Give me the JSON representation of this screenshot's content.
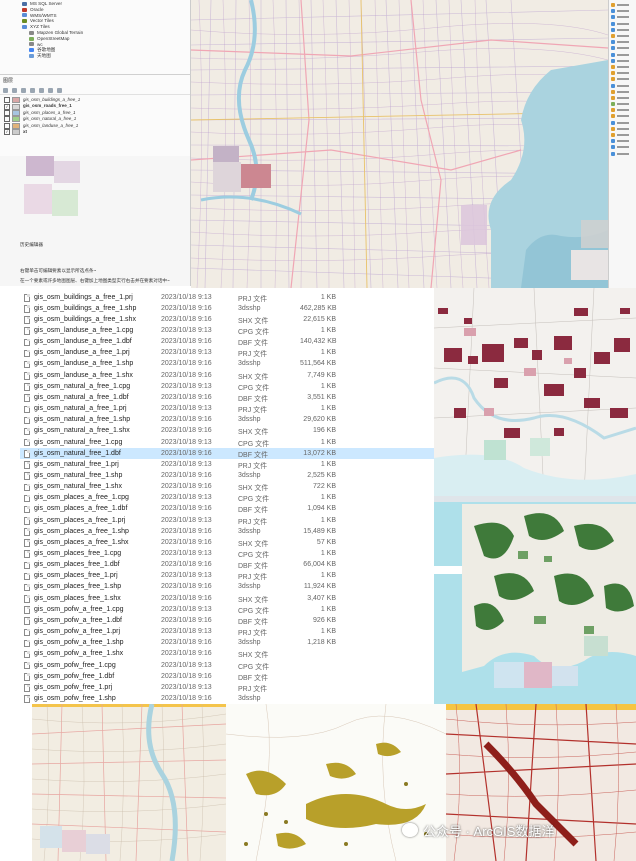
{
  "qgis": {
    "browser_items": [
      {
        "label": "MS SQL Server",
        "color": "#4a6fa5"
      },
      {
        "label": "Oracle",
        "color": "#c0392b"
      },
      {
        "label": "WMS/WMTS",
        "color": "#5b8dd6"
      },
      {
        "label": "Vector Tiles",
        "color": "#6b8e23"
      },
      {
        "label": "XYZ Tiles",
        "color": "#5b8dd6"
      },
      {
        "label": "Mapzen Global Terrain",
        "color": "#888888"
      },
      {
        "label": "OpenStreetMap",
        "color": "#7cae5a"
      },
      {
        "label": "wc",
        "color": "#888888"
      },
      {
        "label": "谷歌地图",
        "color": "#4285f4"
      },
      {
        "label": "天地图",
        "color": "#6a9bd8"
      }
    ],
    "layers_title": "图层",
    "layers": [
      {
        "label": "gis_osm_buildings_a_free_1",
        "checked": "",
        "swatch": "#d9a7a7",
        "bold": false
      },
      {
        "label": "gis_osm_roads_free_1",
        "checked": "✓",
        "swatch": "#d8d8d8",
        "bold": true
      },
      {
        "label": "gis_osm_places_a_free_1",
        "checked": "",
        "swatch": "#a7c4e0",
        "bold": false
      },
      {
        "label": "gis_osm_natural_a_free_1",
        "checked": "",
        "swatch": "#9fcf8a",
        "bold": false
      },
      {
        "label": "gis_osm_landuse_a_free_1",
        "checked": "",
        "swatch": "#e0b27a",
        "bold": false
      },
      {
        "label": "xt",
        "checked": "✓",
        "swatch": "#cccccc",
        "bold": true
      }
    ],
    "bottom_caption": "历史编辑器",
    "bottom_notice_1": "右键单击可编辑要素以显示所选点条~",
    "bottom_notice_2": "在一个要素或许多地图图层、右键加上地图类型实行右击并在要素对话中~",
    "right_panel_icons": [
      "#e0a030",
      "#4a90d9",
      "#4a90d9",
      "#4a90d9",
      "#4a90d9",
      "#e0a030",
      "#4a90d9",
      "#4a90d9",
      "#4a90d9",
      "#4a90d9",
      "#e0a030",
      "#e0a030",
      "#e0a030",
      "#4a90d9",
      "#e0a030",
      "#e0a030",
      "#7cae5a",
      "#e0a030",
      "#e0a030",
      "#4a90d9",
      "#e0a030",
      "#e0a030",
      "#4a90d9",
      "#4a90d9",
      "#4a90d9"
    ]
  },
  "files": [
    {
      "name": "gis_osm_buildings_a_free_1.prj",
      "date": "2023/10/18 9:13",
      "type": "PRJ 文件",
      "size": "1 KB"
    },
    {
      "name": "gis_osm_buildings_a_free_1.shp",
      "date": "2023/10/18 9:16",
      "type": "3dsshp",
      "size": "462,285 KB"
    },
    {
      "name": "gis_osm_buildings_a_free_1.shx",
      "date": "2023/10/18 9:16",
      "type": "SHX 文件",
      "size": "22,615 KB"
    },
    {
      "name": "gis_osm_landuse_a_free_1.cpg",
      "date": "2023/10/18 9:13",
      "type": "CPG 文件",
      "size": "1 KB"
    },
    {
      "name": "gis_osm_landuse_a_free_1.dbf",
      "date": "2023/10/18 9:16",
      "type": "DBF 文件",
      "size": "140,432 KB"
    },
    {
      "name": "gis_osm_landuse_a_free_1.prj",
      "date": "2023/10/18 9:13",
      "type": "PRJ 文件",
      "size": "1 KB"
    },
    {
      "name": "gis_osm_landuse_a_free_1.shp",
      "date": "2023/10/18 9:16",
      "type": "3dsshp",
      "size": "511,564 KB"
    },
    {
      "name": "gis_osm_landuse_a_free_1.shx",
      "date": "2023/10/18 9:16",
      "type": "SHX 文件",
      "size": "7,749 KB"
    },
    {
      "name": "gis_osm_natural_a_free_1.cpg",
      "date": "2023/10/18 9:13",
      "type": "CPG 文件",
      "size": "1 KB"
    },
    {
      "name": "gis_osm_natural_a_free_1.dbf",
      "date": "2023/10/18 9:16",
      "type": "DBF 文件",
      "size": "3,551 KB"
    },
    {
      "name": "gis_osm_natural_a_free_1.prj",
      "date": "2023/10/18 9:13",
      "type": "PRJ 文件",
      "size": "1 KB"
    },
    {
      "name": "gis_osm_natural_a_free_1.shp",
      "date": "2023/10/18 9:16",
      "type": "3dsshp",
      "size": "29,620 KB"
    },
    {
      "name": "gis_osm_natural_a_free_1.shx",
      "date": "2023/10/18 9:16",
      "type": "SHX 文件",
      "size": "196 KB"
    },
    {
      "name": "gis_osm_natural_free_1.cpg",
      "date": "2023/10/18 9:13",
      "type": "CPG 文件",
      "size": "1 KB"
    },
    {
      "name": "gis_osm_natural_free_1.dbf",
      "date": "2023/10/18 9:16",
      "type": "DBF 文件",
      "size": "13,072 KB",
      "selected": true
    },
    {
      "name": "gis_osm_natural_free_1.prj",
      "date": "2023/10/18 9:13",
      "type": "PRJ 文件",
      "size": "1 KB"
    },
    {
      "name": "gis_osm_natural_free_1.shp",
      "date": "2023/10/18 9:16",
      "type": "3dsshp",
      "size": "2,525 KB"
    },
    {
      "name": "gis_osm_natural_free_1.shx",
      "date": "2023/10/18 9:16",
      "type": "SHX 文件",
      "size": "722 KB"
    },
    {
      "name": "gis_osm_places_a_free_1.cpg",
      "date": "2023/10/18 9:13",
      "type": "CPG 文件",
      "size": "1 KB"
    },
    {
      "name": "gis_osm_places_a_free_1.dbf",
      "date": "2023/10/18 9:16",
      "type": "DBF 文件",
      "size": "1,094 KB"
    },
    {
      "name": "gis_osm_places_a_free_1.prj",
      "date": "2023/10/18 9:13",
      "type": "PRJ 文件",
      "size": "1 KB"
    },
    {
      "name": "gis_osm_places_a_free_1.shp",
      "date": "2023/10/18 9:16",
      "type": "3dsshp",
      "size": "15,489 KB"
    },
    {
      "name": "gis_osm_places_a_free_1.shx",
      "date": "2023/10/18 9:16",
      "type": "SHX 文件",
      "size": "57 KB"
    },
    {
      "name": "gis_osm_places_free_1.cpg",
      "date": "2023/10/18 9:13",
      "type": "CPG 文件",
      "size": "1 KB"
    },
    {
      "name": "gis_osm_places_free_1.dbf",
      "date": "2023/10/18 9:16",
      "type": "DBF 文件",
      "size": "66,004 KB"
    },
    {
      "name": "gis_osm_places_free_1.prj",
      "date": "2023/10/18 9:13",
      "type": "PRJ 文件",
      "size": "1 KB"
    },
    {
      "name": "gis_osm_places_free_1.shp",
      "date": "2023/10/18 9:16",
      "type": "3dsshp",
      "size": "11,924 KB"
    },
    {
      "name": "gis_osm_places_free_1.shx",
      "date": "2023/10/18 9:16",
      "type": "SHX 文件",
      "size": "3,407 KB"
    },
    {
      "name": "gis_osm_pofw_a_free_1.cpg",
      "date": "2023/10/18 9:13",
      "type": "CPG 文件",
      "size": "1 KB"
    },
    {
      "name": "gis_osm_pofw_a_free_1.dbf",
      "date": "2023/10/18 9:16",
      "type": "DBF 文件",
      "size": "926 KB"
    },
    {
      "name": "gis_osm_pofw_a_free_1.prj",
      "date": "2023/10/18 9:13",
      "type": "PRJ 文件",
      "size": "1 KB"
    },
    {
      "name": "gis_osm_pofw_a_free_1.shp",
      "date": "2023/10/18 9:16",
      "type": "3dsshp",
      "size": "1,218 KB"
    },
    {
      "name": "gis_osm_pofw_a_free_1.shx",
      "date": "2023/10/18 9:16",
      "type": "SHX 文件",
      "size": ""
    },
    {
      "name": "gis_osm_pofw_free_1.cpg",
      "date": "2023/10/18 9:13",
      "type": "CPG 文件",
      "size": ""
    },
    {
      "name": "gis_osm_pofw_free_1.dbf",
      "date": "2023/10/18 9:16",
      "type": "DBF 文件",
      "size": ""
    },
    {
      "name": "gis_osm_pofw_free_1.prj",
      "date": "2023/10/18 9:13",
      "type": "PRJ 文件",
      "size": ""
    },
    {
      "name": "gis_osm_pofw_free_1.shp",
      "date": "2023/10/18 9:16",
      "type": "3dsshp",
      "size": ""
    }
  ],
  "watermark": {
    "text": "公众号 · ArcGIS数据洋"
  },
  "colors": {
    "selection": "#cce8ff",
    "water": "#aad3df",
    "sea_blue": "#4f8fd6",
    "building": "#8b2a3f",
    "green": "#3f7a3a",
    "road_red": "#b3312c"
  }
}
